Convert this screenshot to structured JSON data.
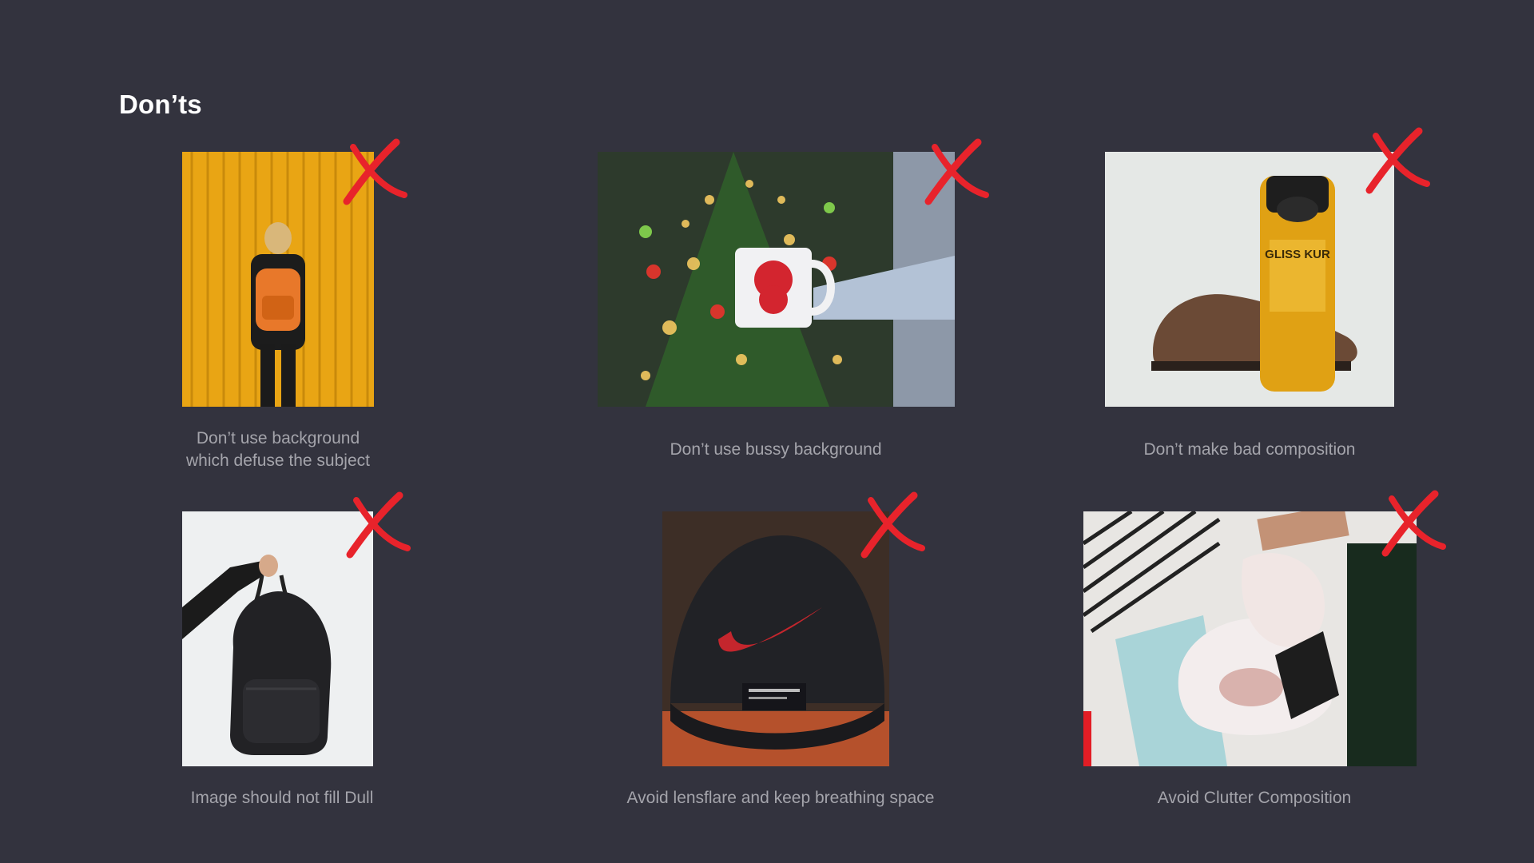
{
  "page": {
    "title": "Don’ts"
  },
  "items": [
    {
      "caption": "Don’t use background\nwhich defuse the subject",
      "image": "woman-orange-backpack-yellow-wall",
      "mark": "red-x-icon"
    },
    {
      "caption": "Don’t use bussy background",
      "image": "santa-mug-christmas-tree",
      "mark": "red-x-icon"
    },
    {
      "caption": "Don’t make bad composition",
      "image": "shoe-and-shampoo-bottle",
      "mark": "red-x-icon"
    },
    {
      "caption": "Image should not fill Dull",
      "image": "hand-holding-black-backpack",
      "mark": "red-x-icon"
    },
    {
      "caption": "Avoid lensflare and keep breathing space",
      "image": "black-nike-cap",
      "mark": "red-x-icon"
    },
    {
      "caption": "Avoid Clutter Composition",
      "image": "sneakers-clothes-flatlay",
      "mark": "red-x-icon"
    }
  ],
  "photo_text": {
    "shampoo_brand": "GLISS KUR"
  },
  "colors": {
    "background": "#33333e",
    "title": "#ffffff",
    "caption": "#a4a4ab",
    "cross": "#e8232b"
  }
}
